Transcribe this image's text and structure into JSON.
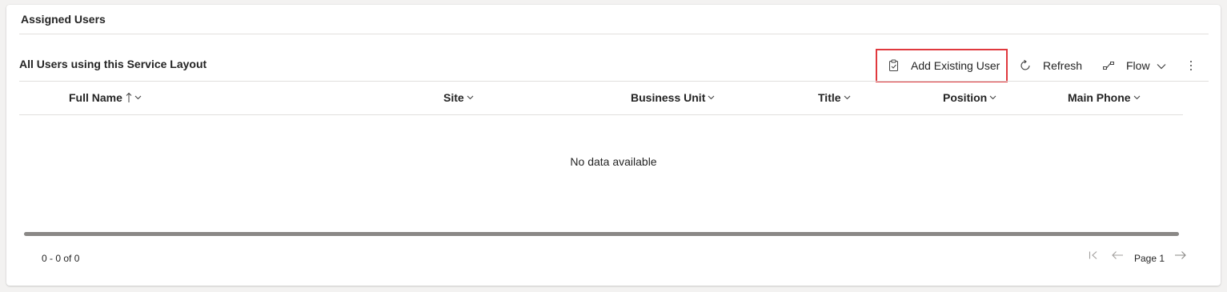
{
  "section": {
    "title": "Assigned Users"
  },
  "subgrid": {
    "title": "All Users using this Service Layout",
    "commands": {
      "add_existing_user": "Add Existing User",
      "refresh": "Refresh",
      "flow": "Flow"
    }
  },
  "columns": [
    {
      "label": "Full Name",
      "sorted": "ascending"
    },
    {
      "label": "Site"
    },
    {
      "label": "Business Unit"
    },
    {
      "label": "Title"
    },
    {
      "label": "Position"
    },
    {
      "label": "Main Phone"
    }
  ],
  "empty_message": "No data available",
  "footer": {
    "record_count": "0 - 0 of 0",
    "page_label": "Page 1"
  },
  "icons": {
    "add_existing_user": "clipboard-add-icon",
    "refresh": "refresh-icon",
    "flow": "flow-icon",
    "more": "more-vertical-icon",
    "first_page": "first-page-icon",
    "prev_page": "arrow-left-icon",
    "next_page": "arrow-right-icon"
  },
  "colors": {
    "highlight": "#e0393e",
    "divider": "#e1dfdd"
  }
}
